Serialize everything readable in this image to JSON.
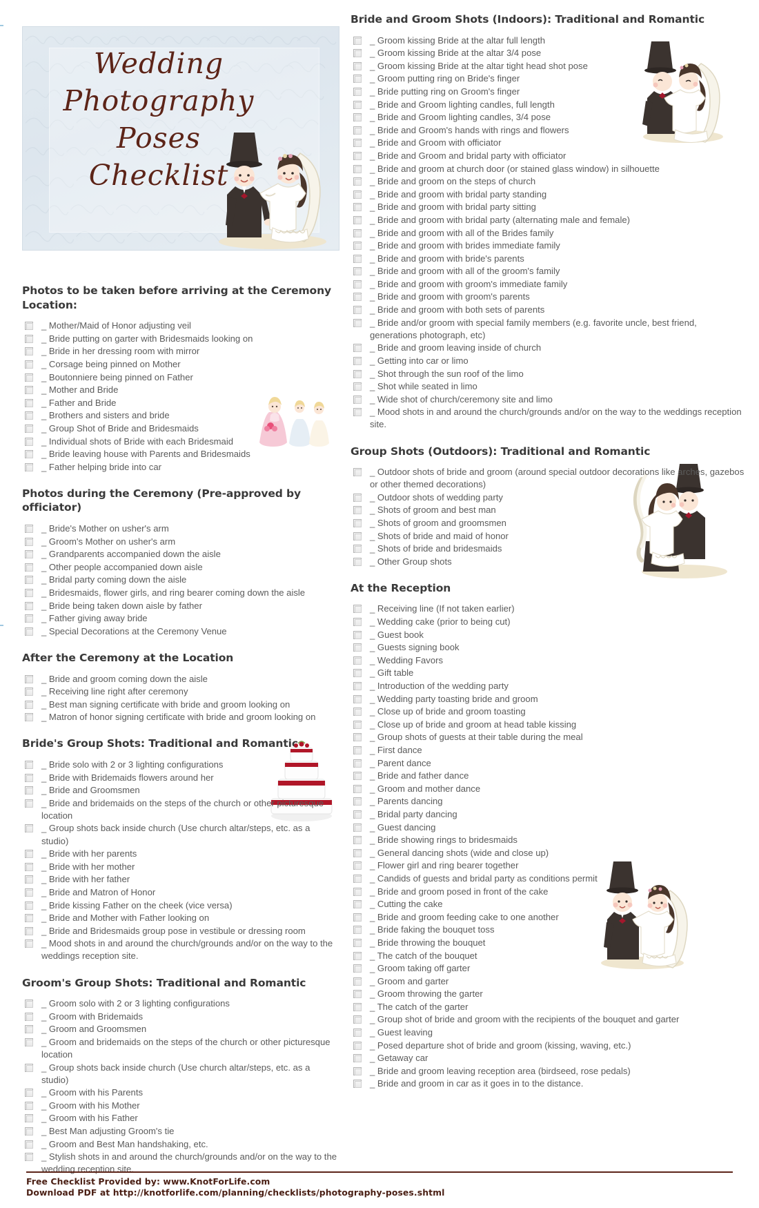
{
  "banner": {
    "title_lines": [
      "Wedding",
      "Photography",
      "Poses",
      "Checklist"
    ]
  },
  "left_column": [
    {
      "heading": "Photos to be taken before arriving at the Ceremony Location:",
      "items": [
        "Mother/Maid of Honor adjusting veil",
        "Bride putting on garter with Bridesmaids looking on",
        "Bride in her dressing room with mirror",
        "Corsage being pinned on Mother",
        "Boutonniere being pinned on Father",
        "Mother and Bride",
        "Father and Bride",
        "Brothers and sisters and bride",
        "Group Shot of Bride and Bridesmaids",
        "Individual shots of Bride with each Bridesmaid",
        "Bride leaving house with Parents and Bridesmaids",
        "Father helping bride into car"
      ]
    },
    {
      "heading": "Photos during the Ceremony (Pre-approved by officiator)",
      "items": [
        "Bride's Mother on usher's arm",
        "Groom's Mother on usher's arm",
        "Grandparents accompanied down the aisle",
        "Other people accompanied down aisle",
        "Bridal party coming down the aisle",
        "Bridesmaids, flower girls, and ring bearer coming down the aisle",
        "Bride being taken down aisle by father",
        "Father giving away bride",
        "Special Decorations at the Ceremony Venue"
      ]
    },
    {
      "heading": "After the Ceremony at the Location",
      "items": [
        "Bride and groom coming down the aisle",
        "Receiving line right after ceremony",
        "Best man signing certificate with bride and groom looking on",
        "Matron of honor signing certificate with bride and groom looking on"
      ]
    },
    {
      "heading": "Bride's Group Shots: Traditional and Romantic",
      "items": [
        "Bride solo with 2 or 3 lighting configurations",
        "Bride with Bridemaids flowers around her",
        "Bride and Groomsmen",
        "Bride and bridemaids on the steps of the church or other picturesque location",
        "Group shots back inside church  (Use church altar/steps, etc. as a studio)",
        "Bride with her parents",
        "Bride with her mother",
        "Bride with her father",
        "Bride and Matron of Honor",
        "Bride kissing Father on the cheek (vice versa)",
        "Bride and Mother with Father looking on",
        "Bride and Bridesmaids group pose in vestibule or dressing room",
        "Mood shots in and around the church/grounds and/or  on the way to the weddings reception site."
      ]
    },
    {
      "heading": "Groom's Group Shots: Traditional and Romantic",
      "items": [
        "Groom solo with 2 or 3 lighting configurations",
        "Groom with Bridemaids",
        "Groom and Groomsmen",
        "Groom and bridemaids on the steps of the church or other picturesque location",
        "Group shots back inside church  (Use church altar/steps, etc. as a studio)",
        "Groom with his Parents",
        "Groom with his Mother",
        "Groom with his Father",
        "Best Man adjusting Groom's tie",
        "Groom and Best Man handshaking, etc.",
        "Stylish shots in and around the church/grounds and/or  on the way to the wedding reception site."
      ]
    }
  ],
  "right_column": [
    {
      "heading": "Bride and Groom Shots (Indoors): Traditional and Romantic",
      "items": [
        "Groom kissing Bride at the altar full length",
        "Groom kissing Bride at the altar 3/4 pose",
        "Groom kissing Bride at the altar tight head shot pose",
        "Groom putting ring on Bride's finger",
        "Bride putting ring on Groom's finger",
        "Bride and Groom lighting candles, full length",
        "Bride and Groom lighting candles, 3/4 pose",
        "Bride and Groom's hands with rings and flowers",
        "Bride and Groom with officiator",
        "Bride and Groom and bridal party with officiator",
        "Bride and groom at church door (or stained glass window) in silhouette",
        "Bride and groom on the steps of church",
        "Bride and groom with bridal party standing",
        "Bride and groom with bridal party sitting",
        "Bride and groom with bridal party  (alternating male and female)",
        "Bride and groom with all of the Brides family",
        "Bride and groom with brides immediate family",
        "Bride and groom with bride's parents",
        "Bride and groom with all of the groom's family",
        "Bride and groom with groom's immediate family",
        "Bride and groom with groom's parents",
        "Bride and groom with both sets of parents",
        "Bride and/or groom with special family members  (e.g. favorite uncle, best friend, generations photograph, etc)",
        "Bride and groom leaving inside of church",
        "Getting into car or limo",
        "Shot through the sun roof of the limo",
        "Shot while seated in limo",
        "Wide shot of church/ceremony site and limo",
        "Mood shots in and around the church/grounds and/or  on the way to the weddings reception site."
      ]
    },
    {
      "heading": "Group Shots (Outdoors): Traditional and Romantic",
      "items": [
        "Outdoor shots of bride and groom (around special outdoor decorations like arches, gazebos or other themed decorations)",
        "Outdoor shots of wedding party",
        "Shots of groom and best man",
        "Shots of groom and groomsmen",
        "Shots of bride and maid of honor",
        "Shots of bride and bridesmaids",
        "Other Group shots"
      ]
    },
    {
      "heading": "At the Reception",
      "items": [
        "Receiving line (If not taken earlier)",
        "Wedding cake (prior to being cut)",
        "Guest book",
        "Guests signing book",
        "Wedding Favors",
        "Gift table",
        "Introduction of the wedding party",
        "Wedding party toasting bride and groom",
        "Close up of bride and groom toasting",
        "Close up of bride and groom at head table kissing",
        "Group shots of guests at their table during the meal",
        "First dance",
        "Parent dance",
        "Bride and father dance",
        "Groom and mother dance",
        "Parents dancing",
        "Bridal party dancing",
        "Guest dancing",
        "Bride showing rings to bridesmaids",
        "General dancing shots (wide and close up)",
        "Flower girl and ring bearer together",
        "Candids of guests and bridal party as conditions permit",
        "Bride and groom posed in front of the cake",
        "Cutting the cake",
        "Bride and groom feeding cake to one another",
        "Bride faking the bouquet toss",
        "Bride throwing the bouquet",
        "The catch of the bouquet",
        "Groom taking off garter",
        "Groom and garter",
        "Groom throwing the garter",
        "The catch of the garter",
        "Group shot of bride and groom with the recipients of the  bouquet and garter",
        "Guest leaving",
        "Posed departure shot of bride and groom (kissing, waving, etc.)",
        "Getaway car",
        "Bride and groom leaving reception area (birdseed, rose pedals)",
        "Bride and groom in car as it goes in to the distance."
      ]
    }
  ],
  "footer": {
    "line1": "Free Checklist Provided by: www.KnotForLife.com",
    "line2": "Download PDF at http://knotforlife.com/planning/checklists/photography-poses.shtml"
  },
  "colors": {
    "title_maroon": "#5c2418",
    "body_gray": "#5b5b5b",
    "heading_gray": "#3a3a3a",
    "banner_blue": "#e2eaf0",
    "cake_red": "#b01628"
  }
}
